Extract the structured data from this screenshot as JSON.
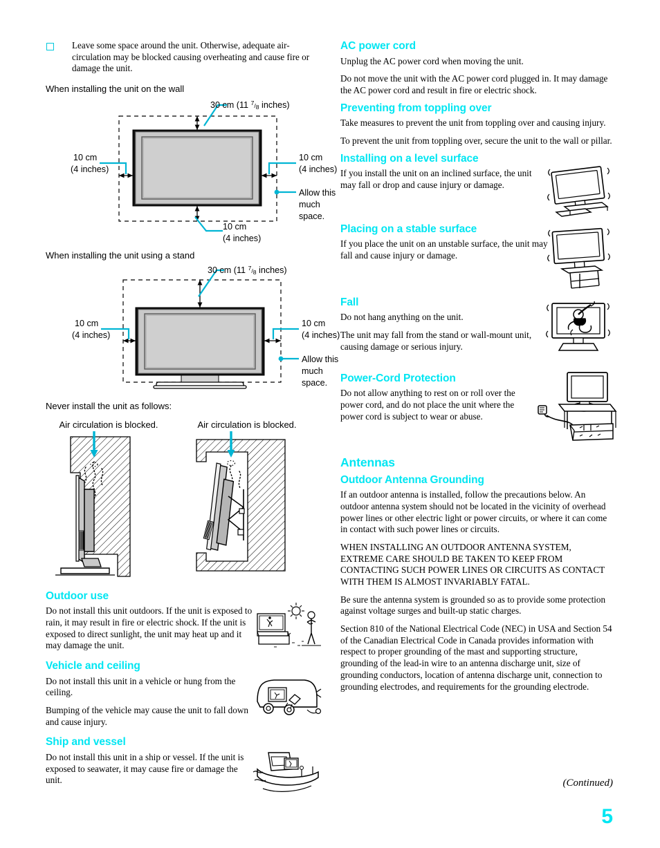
{
  "page": {
    "number": "5",
    "continued_label": "(Continued)"
  },
  "left_column": {
    "intro_bullet": "Leave some space around the unit. Otherwise, adequate air-circulation may be blocked causing overheating and cause fire or damage the unit.",
    "wall_caption": "When installing the unit on the wall",
    "stand_caption": "When installing the unit using a stand",
    "never_install_caption": "Never install the unit as follows:",
    "blocked_caption_left": "Air circulation is blocked.",
    "blocked_caption_right": "Air circulation is blocked.",
    "diagram_labels": {
      "top_30cm_prefix": "30 cm (11 ",
      "top_30cm_sup": "7",
      "top_30cm_slash": "/",
      "top_30cm_sub": "8",
      "top_30cm_suffix": " inches)",
      "left_10cm_line1": "10 cm",
      "left_10cm_line2": "(4 inches)",
      "right_10cm_line1": "10 cm",
      "right_10cm_line2": "(4 inches)",
      "bottom_10cm_line1": "10 cm",
      "bottom_10cm_line2": "(4 inches)",
      "allow_line1": "Allow this",
      "allow_line2": "much",
      "allow_line3": "space."
    },
    "sections": [
      {
        "heading": "Outdoor use",
        "paragraphs": [
          "Do not install this unit outdoors. If the unit is exposed to rain, it may result in fire or electric shock. If the unit is exposed to direct sunlight, the unit may heat up and it may damage the unit."
        ],
        "icon": "tv-in-sunlight-illustration"
      },
      {
        "heading": "Vehicle and ceiling",
        "paragraphs": [
          "Do not install this unit in a vehicle or hung from the ceiling.",
          "Bumping of the vehicle may cause the unit to fall down and cause injury."
        ],
        "icon": "tv-in-caravan-illustration"
      },
      {
        "heading": "Ship and vessel",
        "paragraphs": [
          "Do not install this unit in a ship or vessel. If the unit is exposed to seawater, it may cause fire or damage the unit."
        ],
        "icon": "tv-on-boat-illustration"
      }
    ]
  },
  "right_column": {
    "sections": [
      {
        "heading": "AC power cord",
        "paragraphs": [
          "Unplug the AC power cord when moving the unit.",
          "Do not move the unit with the AC power cord plugged in. It may damage the AC power cord and result in fire or electric shock."
        ],
        "icon": null
      },
      {
        "heading": "Preventing from toppling over",
        "paragraphs": [
          "Take measures to prevent the unit from toppling over and causing injury.",
          "To prevent the unit from toppling over, secure the unit to the wall or pillar."
        ],
        "icon": null
      },
      {
        "heading": "Installing on a level surface",
        "paragraphs": [
          "If you install the unit on an inclined surface, the unit may fall or drop and cause injury or damage."
        ],
        "icon": "tv-on-inclined-surface-illustration"
      },
      {
        "heading": "Placing on a stable surface",
        "paragraphs": [
          "If you place the unit on an unstable surface, the unit may fall and cause injury or damage."
        ],
        "icon": "tv-on-unstable-stool-illustration"
      },
      {
        "heading": "Fall",
        "paragraphs": [
          "Do not hang anything on the unit.",
          "The unit may fall from the stand or wall-mount unit, causing damage or serious injury."
        ],
        "icon": "child-hanging-on-tv-illustration"
      },
      {
        "heading": "Power-Cord Protection",
        "paragraphs": [
          "Do not allow anything to rest on or roll over the power cord, and do not place the unit where the power cord is subject to wear or abuse."
        ],
        "icon": "power-cord-under-furniture-illustration"
      }
    ],
    "antennas": {
      "heading": "Antennas",
      "sub_heading": "Outdoor Antenna Grounding",
      "paragraphs": [
        "If an outdoor antenna is installed, follow the precautions below. An outdoor antenna system should not be located in the vicinity of overhead power lines or other electric light or power circuits, or where it can come in contact with such power lines or circuits.",
        "WHEN INSTALLING AN OUTDOOR ANTENNA SYSTEM, EXTREME CARE SHOULD BE TAKEN TO KEEP FROM CONTACTING SUCH POWER LINES OR CIRCUITS AS CONTACT WITH THEM IS ALMOST INVARIABLY FATAL.",
        "Be sure the antenna system is grounded so as to provide some protection against voltage surges and built-up static charges.",
        "Section 810 of the National Electrical Code (NEC) in USA and Section 54 of the Canadian Electrical Code in Canada provides information with respect to proper grounding of the mast and supporting structure, grounding of the lead-in wire to an antenna discharge unit, size of grounding conductors, location of antenna discharge unit, connection to grounding electrodes, and requirements for the grounding electrode."
      ]
    }
  },
  "colors": {
    "heading_cyan": "#00e6f2",
    "diagram_cyan": "#00b5d4",
    "text_black": "#000000",
    "panel_gray": "#c8c8c8"
  }
}
